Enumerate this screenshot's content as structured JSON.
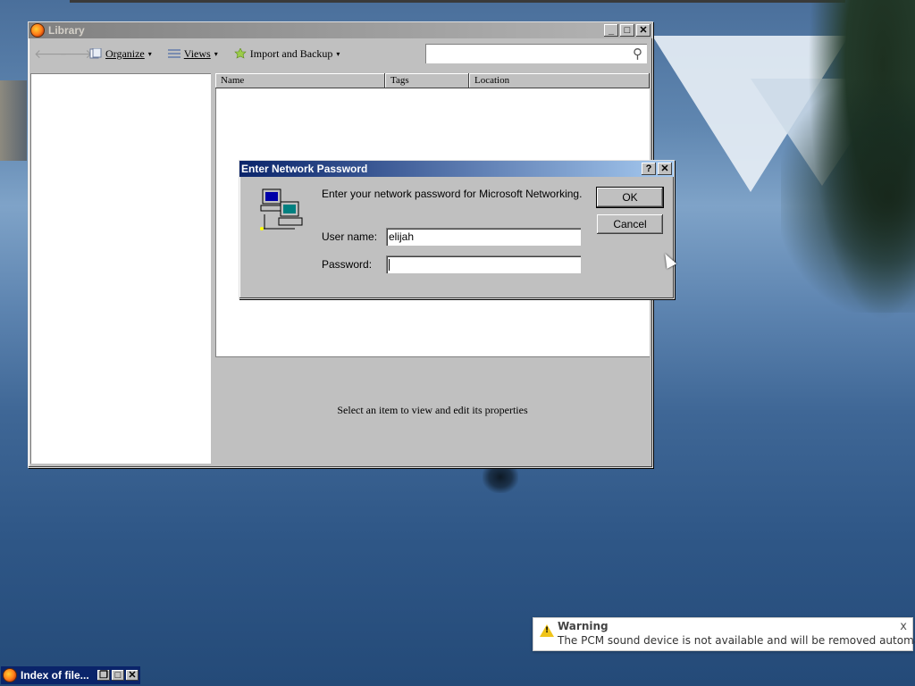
{
  "library": {
    "title": "Library",
    "toolbar": {
      "organize": "Organize",
      "views": "Views",
      "import_backup": "Import and Backup"
    },
    "search": {
      "value": "",
      "placeholder": ""
    },
    "columns": [
      "Name",
      "Tags",
      "Location"
    ],
    "details_message": "Select an item to view and edit its properties"
  },
  "dialog": {
    "title": "Enter Network Password",
    "prompt": "Enter your network password for Microsoft Networking.",
    "username_label": "User name:",
    "username_value": "elijah",
    "password_label": "Password:",
    "password_value": "",
    "ok_label": "OK",
    "cancel_label": "Cancel",
    "help_btn": "?",
    "close_btn": "✕"
  },
  "notification": {
    "title": "Warning",
    "message": "The PCM sound device is not available and will be removed automatically.",
    "close": "x"
  },
  "taskbar": {
    "item_label": "Index of file..."
  },
  "window_buttons": {
    "minimize": "_",
    "maximize": "□",
    "close": "✕",
    "restore": "❐"
  },
  "colors": {
    "active_title": "#0a246a",
    "inactive_title": "#808080",
    "face": "#c0c0c0",
    "warning": "#f0c419"
  }
}
